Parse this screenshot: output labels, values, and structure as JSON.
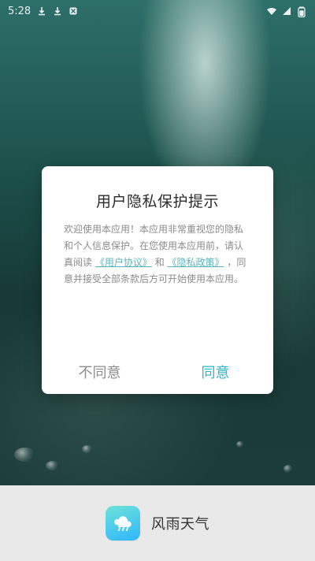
{
  "status_bar": {
    "time": "5:28"
  },
  "dialog": {
    "title": "用户隐私保护提示",
    "body": {
      "text_1": "欢迎使用本应用！本应用非常重视您的隐私和个人信息保护。在您使用本应用前，请认真阅读",
      "link_user_agreement": "《用户协议》",
      "and": "和",
      "link_privacy_policy": "《隐私政策》",
      "text_2": "，同意并接受全部条款后方可开始使用本应用。"
    },
    "buttons": {
      "disagree": "不同意",
      "agree": "同意"
    }
  },
  "brand": {
    "app_name": "风雨天气",
    "icon_name": "weather-cloud-rain-icon"
  },
  "colors": {
    "accent": "#2eb7c9",
    "link": "#59b6bf"
  }
}
